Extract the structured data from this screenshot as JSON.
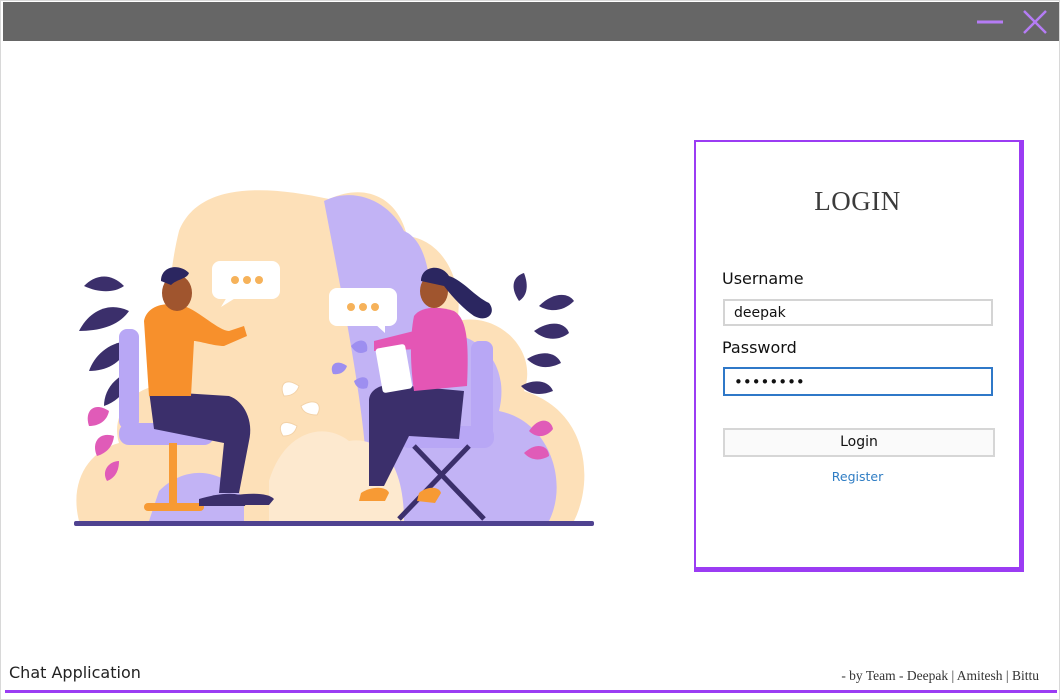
{
  "window": {
    "minimize_icon": "minimize-icon",
    "close_icon": "close-icon",
    "titlebar_color": "#666666",
    "accent_color": "#9b3cf3"
  },
  "illustration": {
    "description_icon": "two-people-chatting-illustration"
  },
  "login": {
    "title": "LOGIN",
    "username_label": "Username",
    "username_value": "deepak",
    "password_label": "Password",
    "password_value": "••••••••",
    "login_button": "Login",
    "register_link": "Register"
  },
  "footer": {
    "app_name": "Chat Application",
    "credits": "- by Team - Deepak | Amitesh | Bittu"
  }
}
